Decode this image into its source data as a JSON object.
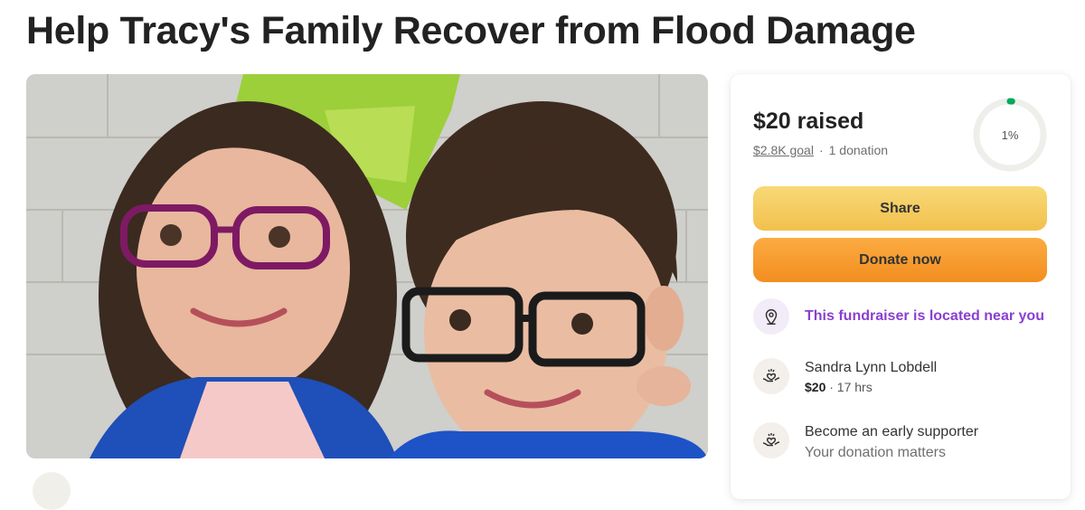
{
  "page": {
    "title": "Help Tracy's Family Recover from Flood Damage"
  },
  "campaign": {
    "raised_text": "$20 raised",
    "goal_text": "$2.8K goal",
    "separator": "·",
    "donation_count_text": "1 donation",
    "progress_percent": 1,
    "progress_label": "1%"
  },
  "actions": {
    "share_label": "Share",
    "donate_label": "Donate now"
  },
  "location": {
    "text": "This fundraiser is located near you",
    "icon": "map-pin-icon"
  },
  "donations": [
    {
      "name": "Sandra Lynn Lobdell",
      "amount": "$20",
      "time": " · 17 hrs",
      "icon": "heart-hand-icon"
    }
  ],
  "early_supporter": {
    "title": "Become an early supporter",
    "subtitle": "Your donation matters",
    "icon": "heart-hand-icon"
  },
  "colors": {
    "accent_purple": "#8a3fd0",
    "progress_green": "#02a95c",
    "share_yellow": "#f6cf60",
    "donate_orange": "#f7941d"
  }
}
